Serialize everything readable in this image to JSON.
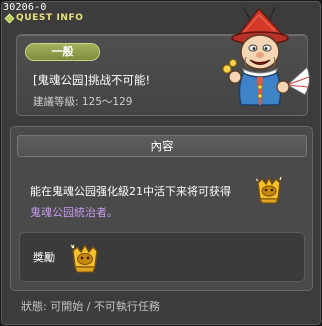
{
  "window": {
    "quest_id": "30206-0",
    "title": "QUEST INFO"
  },
  "summary": {
    "grade": "一般",
    "quest_title": "[鬼魂公园]挑战不可能!",
    "level_text": "建議等級: 125～129"
  },
  "content": {
    "header": "內容",
    "description_line1": "能在鬼魂公园强化級21中活下来将可获得",
    "description_line2": "鬼魂公园統治者。",
    "reward_label": "獎勵"
  },
  "status": {
    "text": "狀態: 可開始 / 不可執行任務"
  },
  "colors": {
    "title_yellow": "#e9e27c",
    "grade_green": "#8e9c48",
    "highlight_purple": "#c99cf2"
  },
  "icons": {
    "npc": "jester-npc-illustration",
    "medal": "gold-medal-icon"
  }
}
